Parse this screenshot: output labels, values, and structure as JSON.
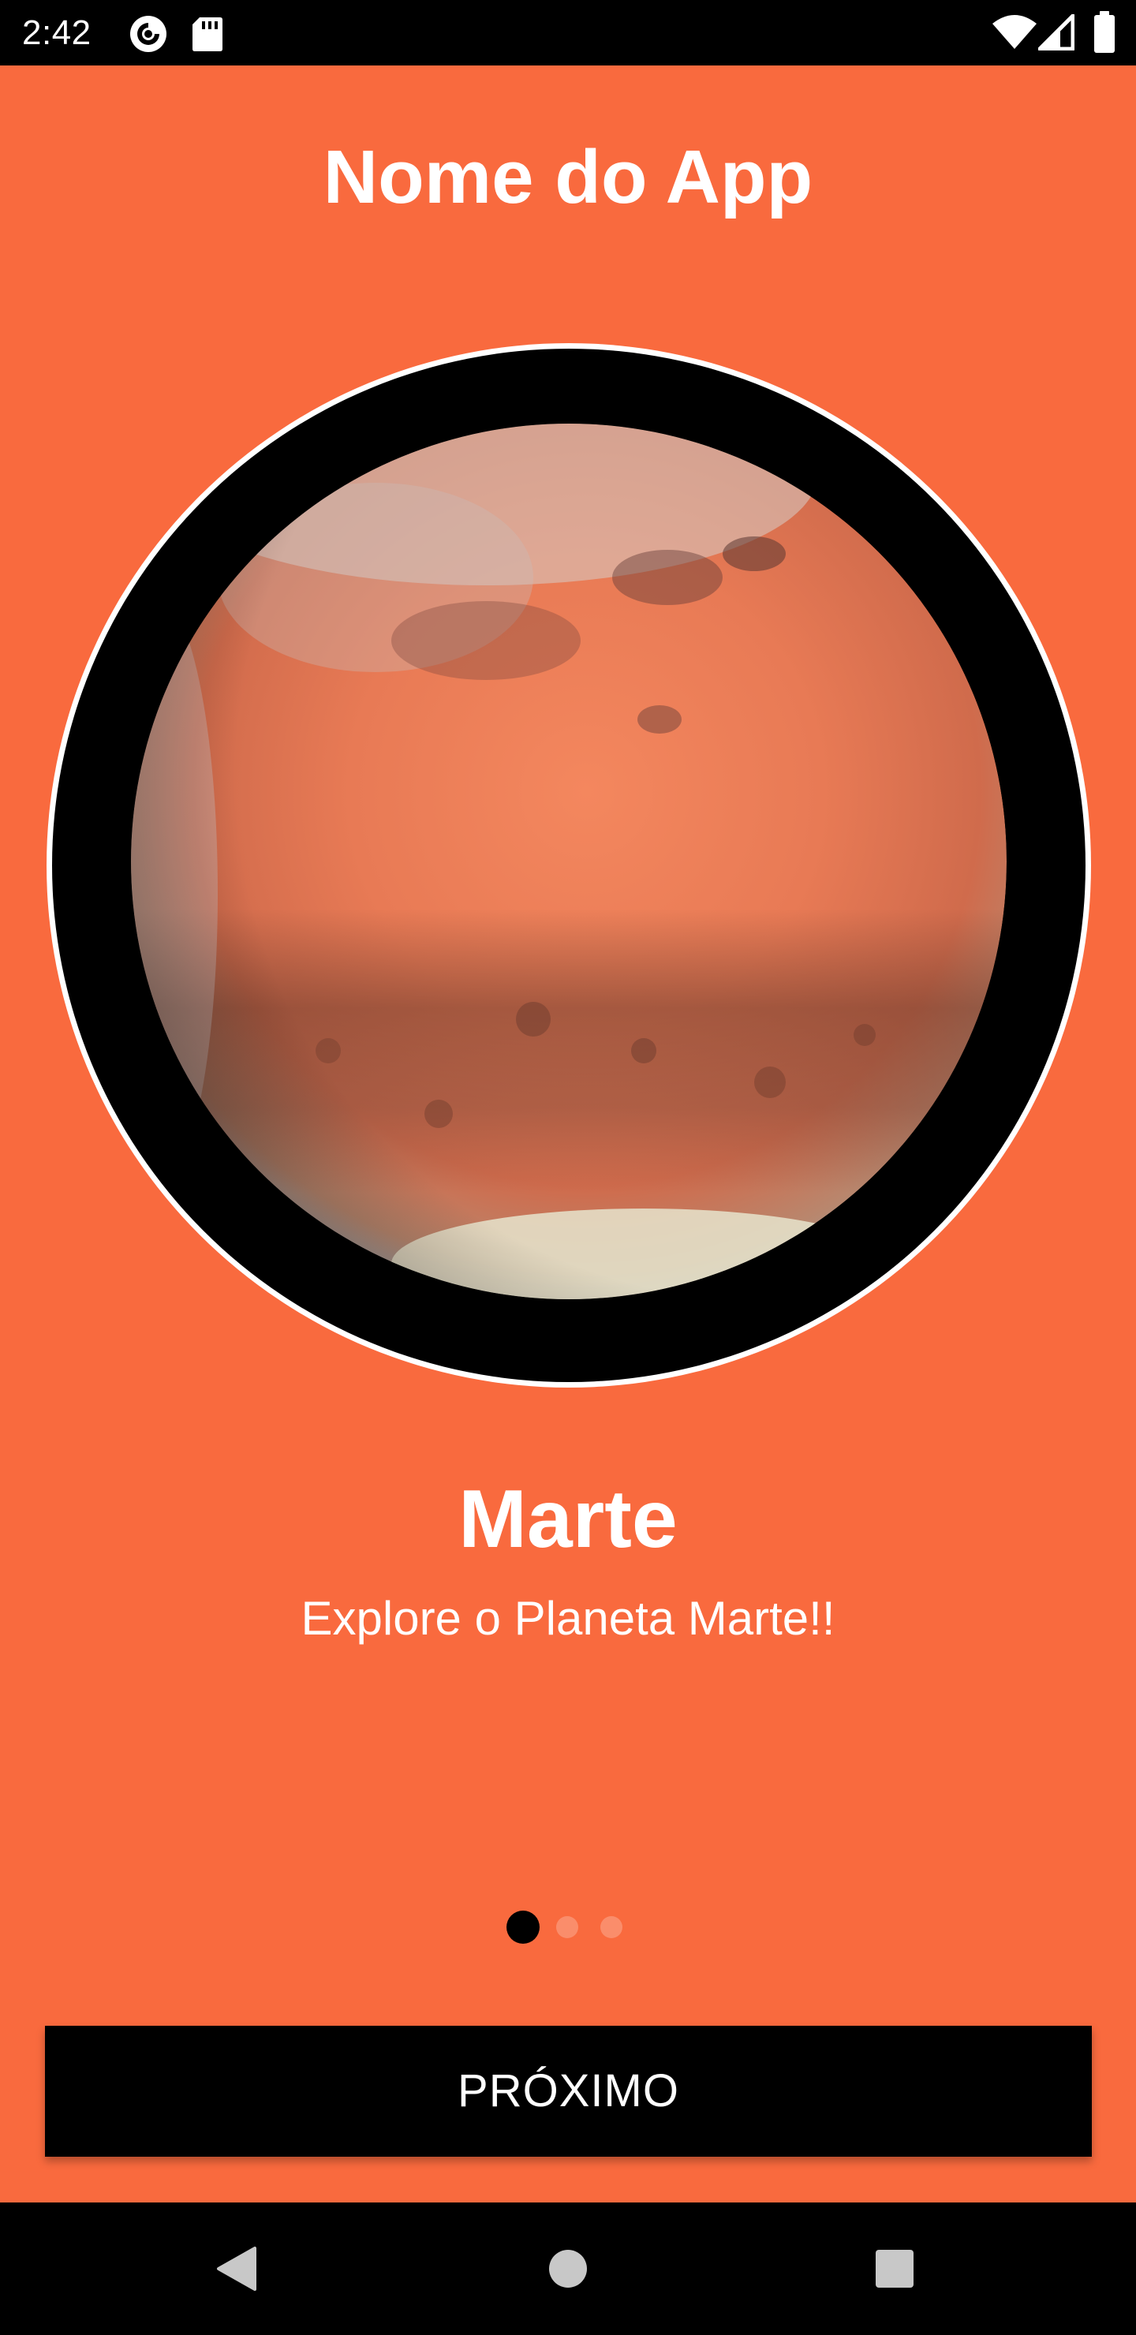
{
  "status_bar": {
    "time": "2:42",
    "left_icons": [
      "pocket-casts-icon",
      "sd-card-icon"
    ],
    "right_icons": [
      "wifi-icon",
      "cellular-signal-icon",
      "battery-icon"
    ]
  },
  "app": {
    "title": "Nome do App",
    "background_color": "#F96A3E"
  },
  "slide": {
    "image": "planet-mars-image",
    "title": "Marte",
    "subtitle": "Explore o Planeta Marte!!"
  },
  "pager": {
    "total": 3,
    "active_index": 0
  },
  "next_button": {
    "label": "PRÓXIMO"
  },
  "nav_bar": {
    "buttons": [
      "back-icon",
      "home-icon",
      "recents-icon"
    ]
  }
}
